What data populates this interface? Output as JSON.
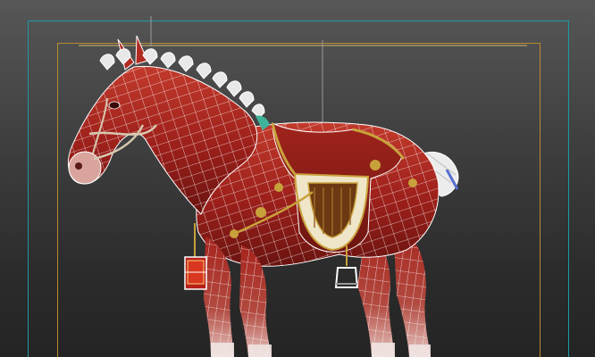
{
  "viewport": {
    "background_top": "#575757",
    "background_bottom": "#242424",
    "safe_frame_color": "#1a9aa8",
    "render_frame_color": "#b88a2e",
    "wireframe_color": "#ffffff",
    "model_color": "#a8231e",
    "saddle_color": "#8a1a15",
    "trim_color": "#c9a13b",
    "mane_color": "#e8e8e8",
    "tail_color": "#ededed"
  },
  "model": {
    "icon": "horse-model",
    "parts": [
      "head",
      "neck",
      "mane",
      "body",
      "saddle",
      "stirrup",
      "lantern",
      "tail",
      "legs"
    ]
  }
}
